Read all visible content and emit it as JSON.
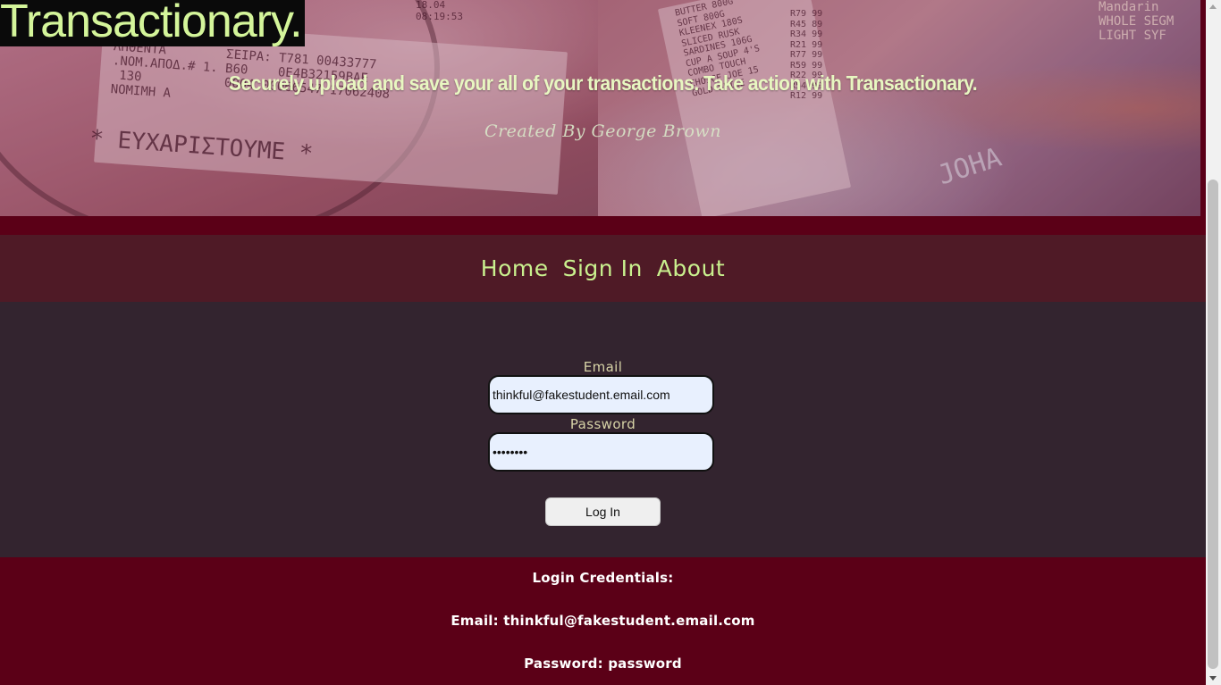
{
  "hero": {
    "brand": "Transactionary.",
    "tagline": "Securely upload and save your all of your transactions. Take action with Transactionary.",
    "credit": "Created By George Brown"
  },
  "nav": {
    "items": [
      {
        "label": "Home"
      },
      {
        "label": "Sign In"
      },
      {
        "label": "About"
      }
    ]
  },
  "form": {
    "email_label": "Email",
    "email_value": "thinkful@fakestudent.email.com",
    "password_label": "Password",
    "password_value": "password",
    "submit_label": "Log In"
  },
  "footer": {
    "heading": "Login Credentials:",
    "email_line": "Email: thinkful@fakestudent.email.com",
    "password_line": "Password: password"
  },
  "colors": {
    "accent_green": "#c9f08e",
    "maroon": "#5b0017",
    "nav_bg": "#4f1a26",
    "panel_bg": "#33242f",
    "input_bg": "#e8f0fe"
  }
}
